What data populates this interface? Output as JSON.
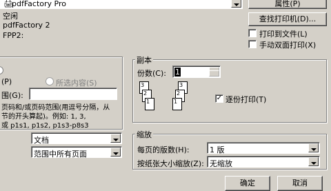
{
  "printer": {
    "name_value": "pdfFactory Pro",
    "properties_button": "属性(P)",
    "find_printer_button": "查找打印机(D)...",
    "status_value": "空闲",
    "type_value": "pdfFactory 2",
    "location_value": "FPP2:",
    "print_to_file_label": "打印到文件(L)",
    "manual_duplex_label": "手动双面打印(X)"
  },
  "page_range": {
    "option_p": "(P)",
    "selection_label": "所选内容(S)",
    "pages_label": "围(G):",
    "pages_value": "",
    "hint_lines": [
      "页码和/或页码范围(用逗号分隔，从",
      "节的开头算起)。例如: 1, 3,",
      "或 p1s1, p1s2, p1s3-p8s3"
    ]
  },
  "print_what": {
    "value": "文档",
    "print_value": "范围中所有页面"
  },
  "copies": {
    "title": "副本",
    "count_label": "份数(C):",
    "count_value": "1",
    "collate_label": "逐份打印(T)",
    "collate_checked": true,
    "page_numbers": [
      "3",
      "2",
      "1",
      "3",
      "2",
      "1"
    ]
  },
  "zoom": {
    "title": "缩放",
    "pages_per_sheet_label": "每页的版数(H):",
    "pages_per_sheet_value": "1 版",
    "scale_label": "按纸张大小缩放(Z):",
    "scale_value": "无缩放"
  },
  "buttons": {
    "ok": "确定",
    "cancel": "取消"
  }
}
